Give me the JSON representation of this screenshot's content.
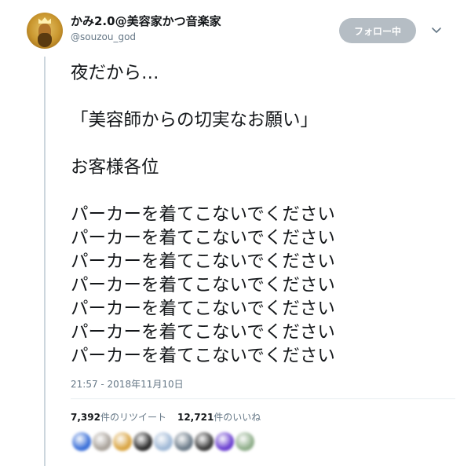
{
  "user": {
    "display_name": "かみ2.0@美容家かつ音楽家",
    "handle": "@souzou_god",
    "avatar_icon": "king-portrait-avatar"
  },
  "follow_button": {
    "label": "フォロー中",
    "color": "#b5bdc4"
  },
  "menu_icon": "chevron-down-icon",
  "tweet": {
    "lines": [
      "夜だから…",
      "",
      "「美容師からの切実なお願い」",
      "",
      "お客様各位",
      "",
      "パーカーを着てこないでください",
      "パーカーを着てこないでください",
      "パーカーを着てこないでください",
      "パーカーを着てこないでください",
      "パーカーを着てこないでください",
      "パーカーを着てこないでください",
      "パーカーを着てこないでください"
    ],
    "timestamp": "21:57 - 2018年11月10日"
  },
  "stats": {
    "retweets": {
      "count": "7,392",
      "label": "件のリツイート"
    },
    "likes": {
      "count": "12,721",
      "label": "件のいいね"
    }
  },
  "likers": [
    {
      "color": "#3a6fd8"
    },
    {
      "color": "#a9a29a"
    },
    {
      "color": "#d9a441"
    },
    {
      "color": "#2b2b2b"
    },
    {
      "color": "#9fb8d6"
    },
    {
      "color": "#6b7a88"
    },
    {
      "color": "#3a3a3a"
    },
    {
      "color": "#6a3fd0"
    },
    {
      "color": "#8fae8a"
    }
  ],
  "colors": {
    "text": "#14171a",
    "secondary": "#657786",
    "thread_line": "#ccd6dd"
  }
}
